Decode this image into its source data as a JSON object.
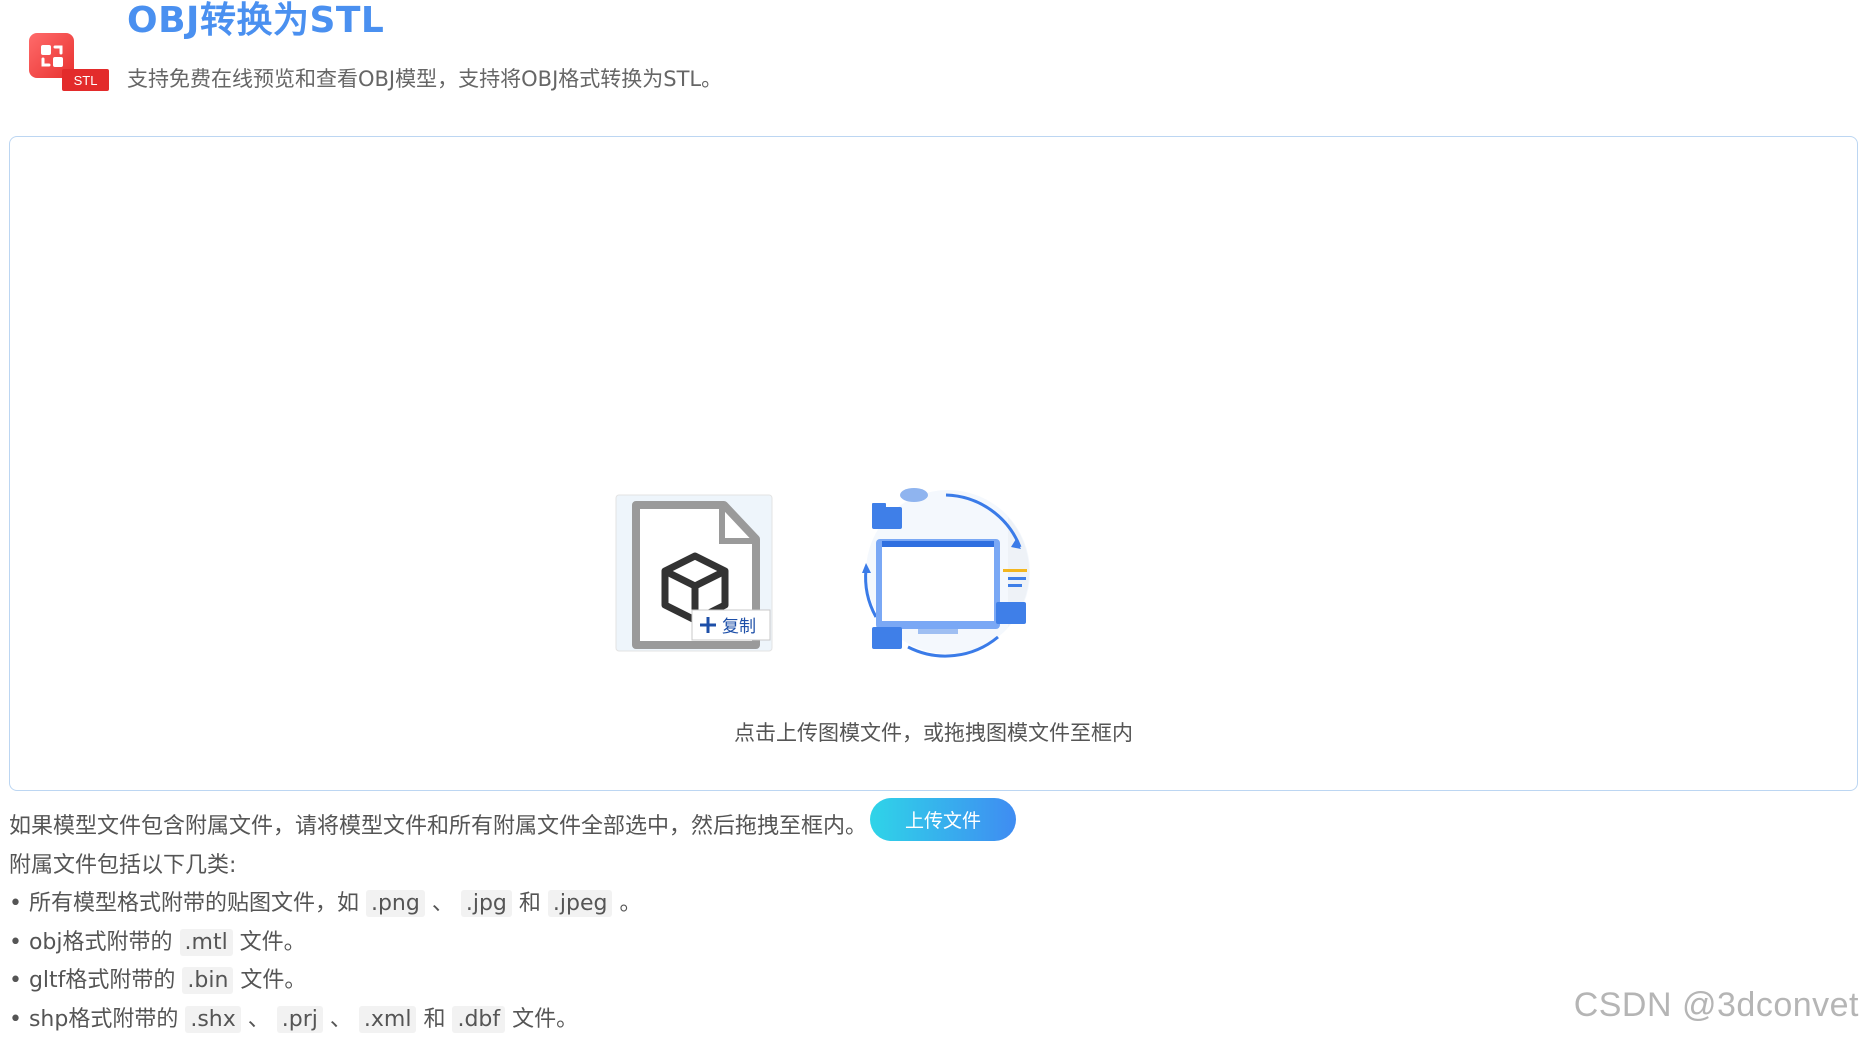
{
  "header": {
    "title": "OBJ转换为STL",
    "subtitle": "支持免费在线预览和查看OBJ模型，支持将OBJ格式转换为STL。",
    "logo_badge": "STL"
  },
  "dropzone": {
    "hint": "点击上传图模文件，或拖拽图模文件至框内",
    "copy_badge": "复制",
    "upload_button": "上传文件"
  },
  "notes": {
    "line1": "如果模型文件包含附属文件，请将模型文件和所有附属文件全部选中，然后拖拽至框内。",
    "line2": "附属文件包括以下几类:",
    "item1": {
      "prefix": "• 所有模型格式附带的贴图文件，如 ",
      "ext1": ".png",
      "sep1": " 、 ",
      "ext2": ".jpg",
      "sep2": " 和 ",
      "ext3": ".jpeg",
      "suffix": " 。"
    },
    "item2": {
      "prefix": "• obj格式附带的 ",
      "ext1": ".mtl",
      "suffix": " 文件。"
    },
    "item3": {
      "prefix": "• gltf格式附带的 ",
      "ext1": ".bin",
      "suffix": " 文件。"
    },
    "item4": {
      "prefix": "• shp格式附带的 ",
      "ext1": ".shx",
      "sep1": " 、 ",
      "ext2": ".prj",
      "sep2": " 、 ",
      "ext3": ".xml",
      "sep3": " 和 ",
      "ext4": ".dbf",
      "suffix": " 文件。"
    }
  },
  "watermark": "CSDN @3dconvet",
  "colors": {
    "title": "#4a90f0",
    "accent_start": "#2fd4e8",
    "accent_end": "#3f8cf2",
    "logo_red": "#e32b2b"
  }
}
